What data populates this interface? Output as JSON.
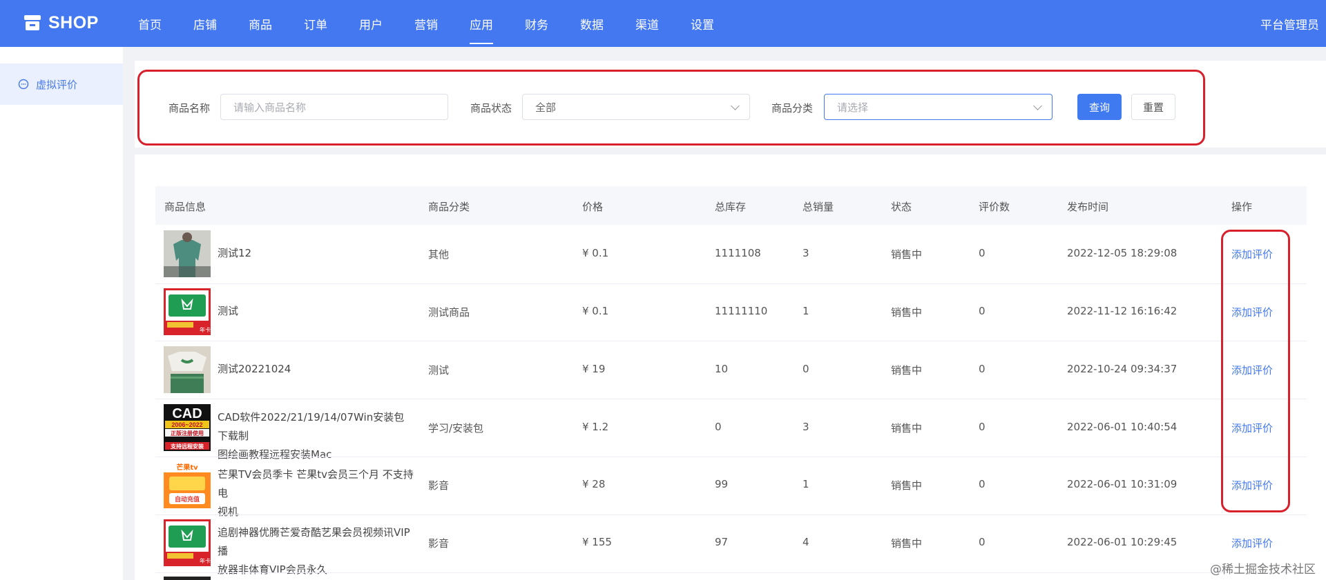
{
  "app": {
    "logo_text": "SHOP",
    "admin_label": "平台管理员"
  },
  "nav": [
    "首页",
    "店铺",
    "商品",
    "订单",
    "用户",
    "营销",
    "应用",
    "财务",
    "数据",
    "渠道",
    "设置"
  ],
  "nav_active": "应用",
  "sidebar": {
    "items": [
      {
        "label": "虚拟评价",
        "icon": "chat-icon"
      }
    ]
  },
  "filter": {
    "name_label": "商品名称",
    "name_placeholder": "请输入商品名称",
    "status_label": "商品状态",
    "status_value": "全部",
    "category_label": "商品分类",
    "category_placeholder": "请选择",
    "query_button": "查询",
    "reset_button": "重置"
  },
  "table": {
    "columns": [
      "商品信息",
      "商品分类",
      "价格",
      "总库存",
      "总销量",
      "状态",
      "评价数",
      "发布时间",
      "操作"
    ],
    "rows": [
      {
        "name": "测试12",
        "category": "其他",
        "price": "¥ 0.1",
        "stock": "1111108",
        "sales": "3",
        "status": "销售中",
        "reviews": "0",
        "published": "2022-12-05 18:29:08",
        "action": "添加评价",
        "thumb": "photo-green-shirt"
      },
      {
        "name": "测试",
        "category": "测试商品",
        "price": "¥ 0.1",
        "stock": "11111110",
        "sales": "1",
        "status": "销售中",
        "reviews": "0",
        "published": "2022-11-12 16:16:42",
        "action": "添加评价",
        "thumb": "vip-card",
        "thumb_caption": "年卡"
      },
      {
        "name": "测试20221024",
        "category": "测试",
        "price": "¥ 19",
        "stock": "10",
        "sales": "0",
        "status": "销售中",
        "reviews": "0",
        "published": "2022-10-24 09:34:37",
        "action": "添加评价",
        "thumb": "photo-clothes"
      },
      {
        "name_lines": [
          "CAD软件2022/21/19/14/07Win安装包下载制",
          "图绘画教程远程安装Mac"
        ],
        "category": "学习/安装包",
        "price": "¥ 1.2",
        "stock": "0",
        "sales": "3",
        "status": "销售中",
        "reviews": "0",
        "published": "2022-06-01 10:40:54",
        "action": "添加评价",
        "thumb": "cad-banner",
        "thumb_title": "CAD",
        "thumb_years": "2006~2022",
        "thumb_sub": "正版注册使用",
        "thumb_bottom": "支持远程安装"
      },
      {
        "name_lines": [
          "芒果TV会员季卡 芒果tv会员三个月 不支持电",
          "视机"
        ],
        "category": "影音",
        "price": "¥ 28",
        "stock": "99",
        "sales": "1",
        "status": "销售中",
        "reviews": "0",
        "published": "2022-06-01 10:31:09",
        "action": "添加评价",
        "thumb": "mango-card",
        "thumb_title": "芒果tv",
        "thumb_mid": "自动充值"
      },
      {
        "name_lines": [
          "追剧神器优腾芒爱奇酷艺果会员视频讯VIP播",
          "放器非体育VIP会员永久"
        ],
        "category": "影音",
        "price": "¥ 155",
        "stock": "97",
        "sales": "4",
        "status": "销售中",
        "reviews": "0",
        "published": "2022-06-01 10:29:45",
        "action": "添加评价",
        "thumb": "vip-card",
        "thumb_caption": "年卡"
      }
    ]
  },
  "watermark": "@稀土掘金技术社区",
  "colors": {
    "primary": "#4478f0",
    "highlight_outline": "#d8202c"
  }
}
